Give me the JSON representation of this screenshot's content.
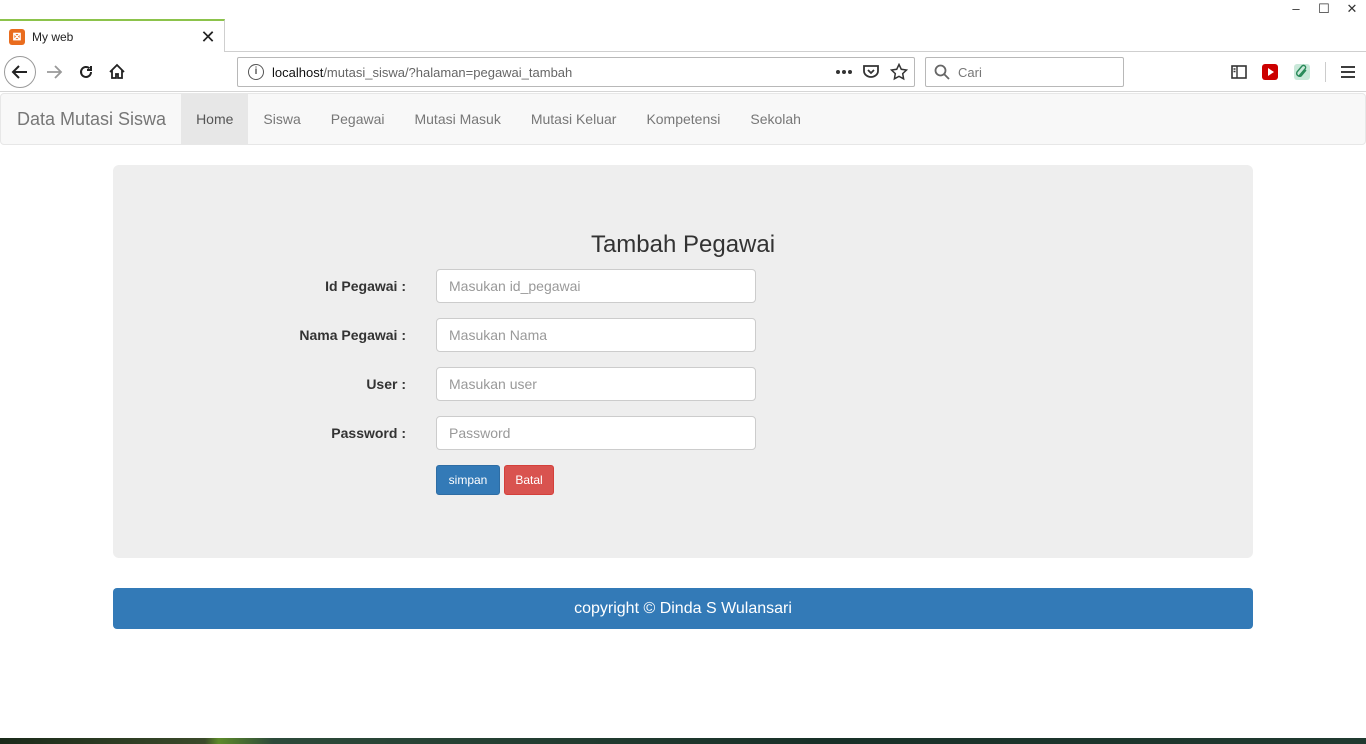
{
  "browser": {
    "tab_title": "My web",
    "tab_close": "✕",
    "url_host": "localhost",
    "url_path": "/mutasi_siswa/?halaman=pegawai_tambah",
    "search_placeholder": "Cari",
    "window_controls": [
      "–",
      "☐",
      "✕"
    ]
  },
  "site": {
    "brand": "Data Mutasi Siswa",
    "nav": [
      {
        "label": "Home",
        "active": true
      },
      {
        "label": "Siswa"
      },
      {
        "label": "Pegawai"
      },
      {
        "label": "Mutasi Masuk"
      },
      {
        "label": "Mutasi Keluar"
      },
      {
        "label": "Kompetensi"
      },
      {
        "label": "Sekolah"
      }
    ]
  },
  "form": {
    "title": "Tambah Pegawai",
    "fields": [
      {
        "label": "Id Pegawai :",
        "placeholder": "Masukan id_pegawai"
      },
      {
        "label": "Nama Pegawai :",
        "placeholder": "Masukan Nama"
      },
      {
        "label": "User :",
        "placeholder": "Masukan user"
      },
      {
        "label": "Password :",
        "placeholder": "Password"
      }
    ],
    "save_label": "simpan",
    "cancel_label": "Batal"
  },
  "footer": {
    "text": "copyright © Dinda S Wulansari"
  },
  "colors": {
    "primary": "#337ab7",
    "danger": "#d9534f",
    "tab_accent": "#8cc34b"
  }
}
